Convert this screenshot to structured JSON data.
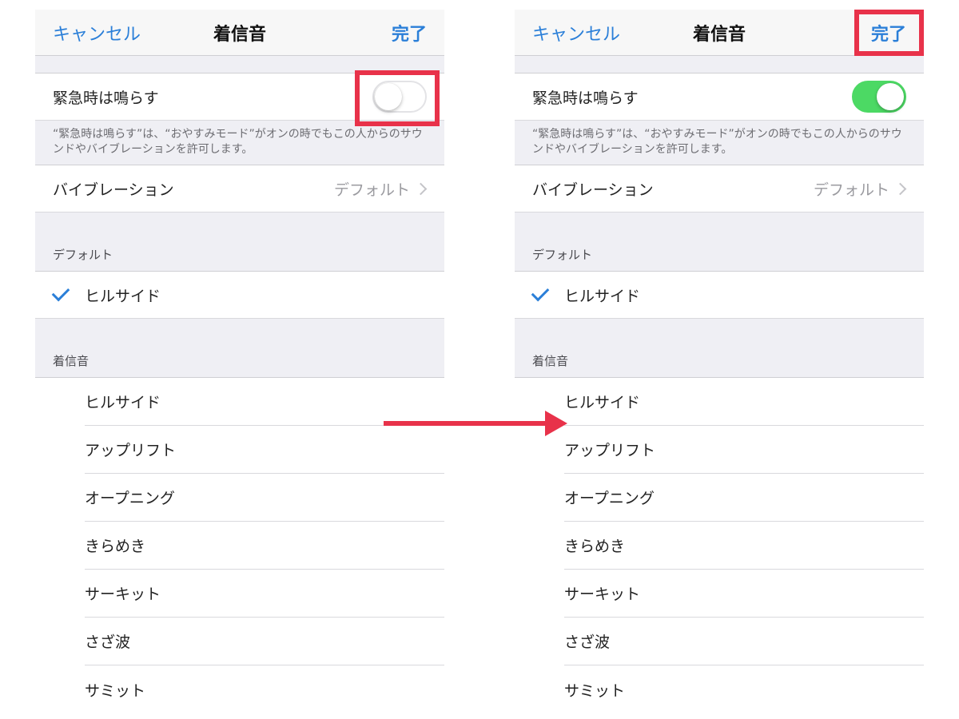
{
  "panels": [
    {
      "nav": {
        "cancel": "キャンセル",
        "title": "着信音",
        "done": "完了"
      },
      "emergency": {
        "label": "緊急時は鳴らす",
        "toggle_on": false
      },
      "footnote": "“緊急時は鳴らす”は、“おやすみモード”がオンの時でもこの人からのサウンドやバイブレーションを許可します。",
      "vibration": {
        "label": "バイブレーション",
        "value": "デフォルト"
      },
      "default_section": {
        "header": "デフォルト",
        "selected": "ヒルサイド"
      },
      "ringtone_section": {
        "header": "着信音",
        "items": [
          "ヒルサイド",
          "アップリフト",
          "オープニング",
          "きらめき",
          "サーキット",
          "さざ波",
          "サミット"
        ]
      }
    },
    {
      "nav": {
        "cancel": "キャンセル",
        "title": "着信音",
        "done": "完了"
      },
      "emergency": {
        "label": "緊急時は鳴らす",
        "toggle_on": true
      },
      "footnote": "“緊急時は鳴らす”は、“おやすみモード”がオンの時でもこの人からのサウンドやバイブレーションを許可します。",
      "vibration": {
        "label": "バイブレーション",
        "value": "デフォルト"
      },
      "default_section": {
        "header": "デフォルト",
        "selected": "ヒルサイド"
      },
      "ringtone_section": {
        "header": "着信音",
        "items": [
          "ヒルサイド",
          "アップリフト",
          "オープニング",
          "きらめき",
          "サーキット",
          "さざ波",
          "サミット"
        ]
      }
    }
  ],
  "colors": {
    "accent": "#2b7fd8",
    "toggle_on": "#4cd964",
    "annotation": "#e8324a"
  }
}
